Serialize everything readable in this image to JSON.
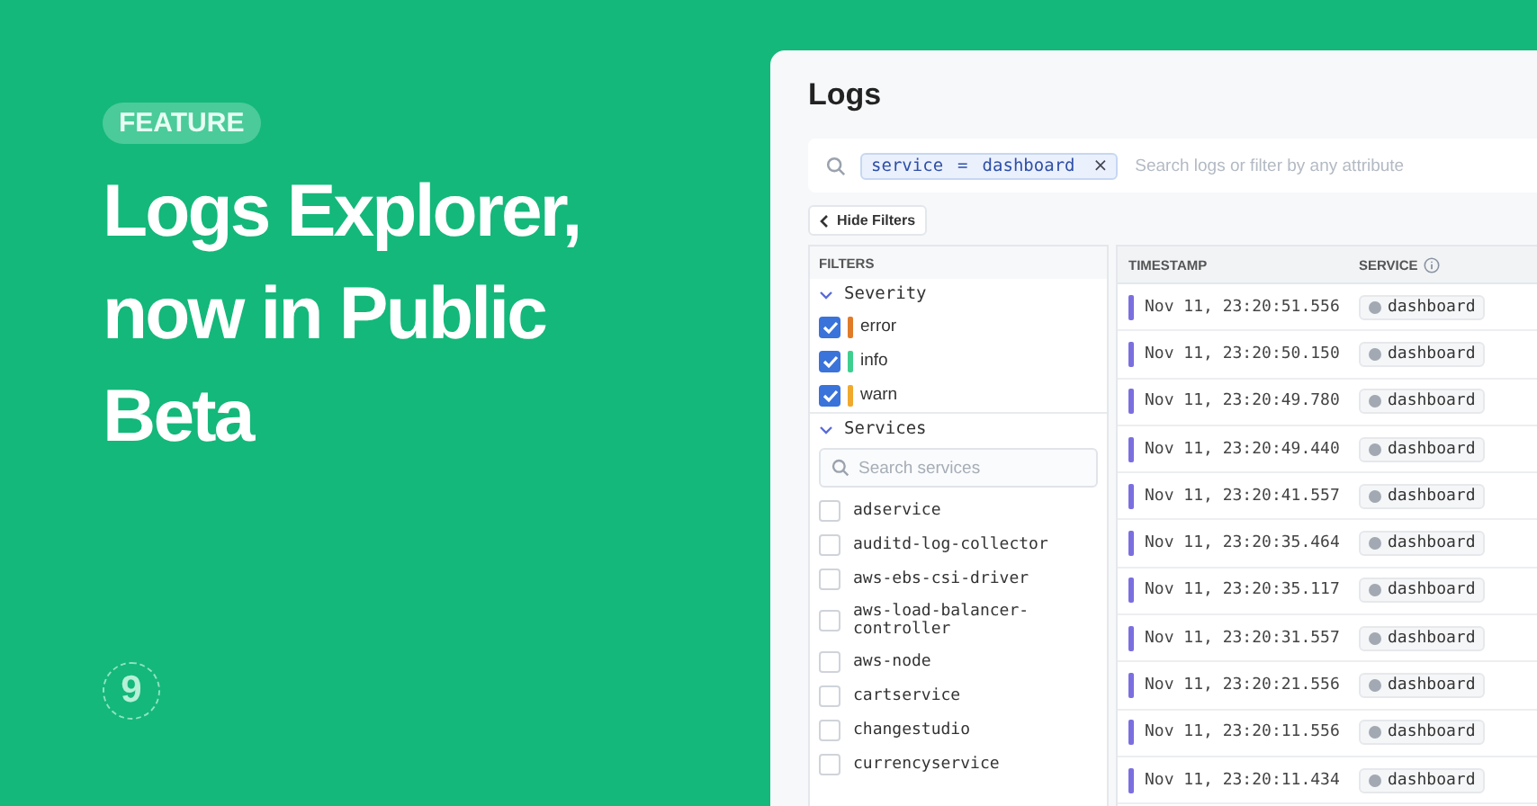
{
  "badge": "FEATURE",
  "headline": "Logs Explorer, now in Public Beta",
  "logo": "9",
  "app": {
    "title": "Logs",
    "search": {
      "chip": {
        "key": "service",
        "operator": "=",
        "value": "dashboard",
        "remove": "×"
      },
      "placeholder": "Search logs or filter by any attribute"
    },
    "hide_filters": "Hide Filters",
    "filters": {
      "title": "FILTERS",
      "groups": [
        {
          "name": "Severity",
          "expanded": true,
          "kind": "severity",
          "items": [
            {
              "label": "error",
              "checked": true,
              "color": "#e07b2a"
            },
            {
              "label": "info",
              "checked": true,
              "color": "#3ecf8e"
            },
            {
              "label": "warn",
              "checked": true,
              "color": "#f0a92d"
            }
          ]
        },
        {
          "name": "Services",
          "expanded": true,
          "kind": "services",
          "search_placeholder": "Search services",
          "items": [
            {
              "label": "adservice",
              "checked": false
            },
            {
              "label": "auditd-log-collector",
              "checked": false
            },
            {
              "label": "aws-ebs-csi-driver",
              "checked": false
            },
            {
              "label": "aws-load-balancer-controller",
              "checked": false
            },
            {
              "label": "aws-node",
              "checked": false
            },
            {
              "label": "cartservice",
              "checked": false
            },
            {
              "label": "changestudio",
              "checked": false
            },
            {
              "label": "currencyservice",
              "checked": false
            }
          ]
        }
      ]
    },
    "table": {
      "columns": [
        "TIMESTAMP",
        "SERVICE"
      ],
      "rows": [
        {
          "timestamp": "Nov 11, 23:20:51.556",
          "service": "dashboard"
        },
        {
          "timestamp": "Nov 11, 23:20:50.150",
          "service": "dashboard"
        },
        {
          "timestamp": "Nov 11, 23:20:49.780",
          "service": "dashboard"
        },
        {
          "timestamp": "Nov 11, 23:20:49.440",
          "service": "dashboard"
        },
        {
          "timestamp": "Nov 11, 23:20:41.557",
          "service": "dashboard"
        },
        {
          "timestamp": "Nov 11, 23:20:35.464",
          "service": "dashboard"
        },
        {
          "timestamp": "Nov 11, 23:20:35.117",
          "service": "dashboard"
        },
        {
          "timestamp": "Nov 11, 23:20:31.557",
          "service": "dashboard"
        },
        {
          "timestamp": "Nov 11, 23:20:21.556",
          "service": "dashboard"
        },
        {
          "timestamp": "Nov 11, 23:20:11.556",
          "service": "dashboard"
        },
        {
          "timestamp": "Nov 11, 23:20:11.434",
          "service": "dashboard"
        }
      ]
    }
  }
}
